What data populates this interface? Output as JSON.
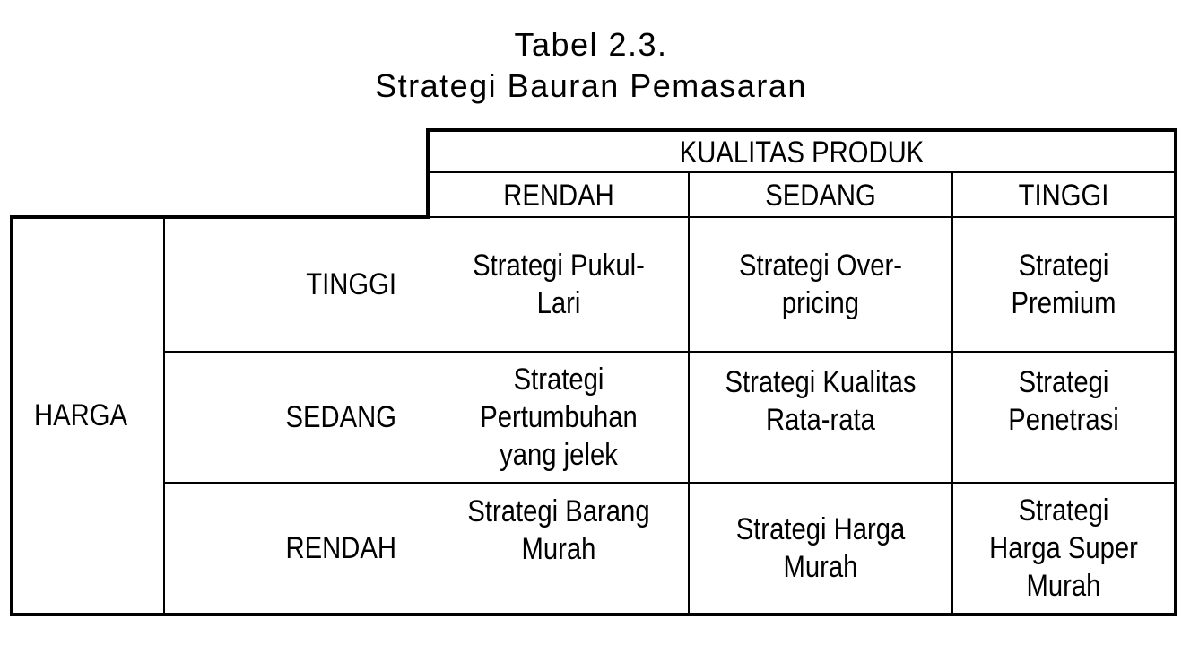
{
  "caption": {
    "line1": "Tabel 2.3.",
    "line2": "Strategi Bauran Pemasaran"
  },
  "table": {
    "column_group_header": "KUALITAS PRODUK",
    "column_headers": [
      "RENDAH",
      "SEDANG",
      "TINGGI"
    ],
    "row_group_header": "HARGA",
    "rows": [
      {
        "label": "TINGGI",
        "cells": [
          "Strategi Pukul-\nLari",
          "Strategi Over-\npricing",
          "Strategi\nPremium"
        ]
      },
      {
        "label": "SEDANG",
        "cells": [
          "Strategi\nPertumbuhan\nyang jelek",
          "Strategi Kualitas\nRata-rata",
          "Strategi\nPenetrasi"
        ]
      },
      {
        "label": "RENDAH",
        "cells": [
          "Strategi Barang\nMurah",
          "Strategi Harga\nMurah",
          "Strategi\nHarga Super\nMurah"
        ]
      }
    ]
  }
}
